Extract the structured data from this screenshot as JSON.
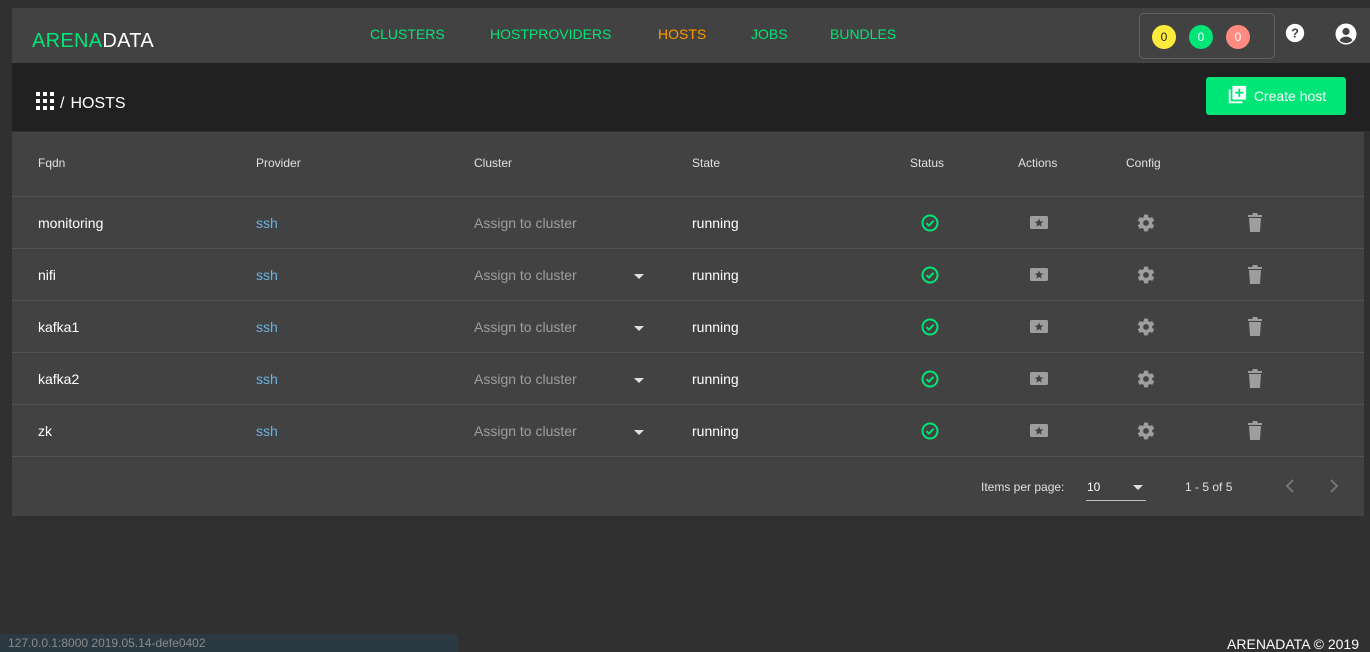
{
  "app": {
    "logo_left": "ARENA",
    "logo_right": "DATA"
  },
  "nav": [
    {
      "label": "CLUSTERS",
      "active": false
    },
    {
      "label": "HOSTPROVIDERS",
      "active": false
    },
    {
      "label": "HOSTS",
      "active": true
    },
    {
      "label": "JOBS",
      "active": false
    },
    {
      "label": "BUNDLES",
      "active": false
    }
  ],
  "job_stats": [
    {
      "value": "0",
      "color": "#ffeb3b",
      "text_color": "#212121"
    },
    {
      "value": "0",
      "color": "#00e676",
      "text_color": "#ffffff"
    },
    {
      "value": "0",
      "color": "#ff8a80",
      "text_color": "#ffffff"
    }
  ],
  "icons": {
    "help": "help-icon",
    "account": "account-icon",
    "apps": "apps-grid-icon",
    "create": "library-add-icon"
  },
  "breadcrumb": {
    "separator": "/",
    "page": "HOSTS"
  },
  "actions": {
    "create_label": "Create host"
  },
  "table": {
    "columns": [
      "Fqdn",
      "Provider",
      "Cluster",
      "State",
      "Status",
      "Actions",
      "Config"
    ],
    "rows": [
      {
        "fqdn": "monitoring",
        "provider": "ssh",
        "cluster": "Assign to cluster",
        "state": "running",
        "has_caret": false
      },
      {
        "fqdn": "nifi",
        "provider": "ssh",
        "cluster": "Assign to cluster",
        "state": "running",
        "has_caret": true
      },
      {
        "fqdn": "kafka1",
        "provider": "ssh",
        "cluster": "Assign to cluster",
        "state": "running",
        "has_caret": true
      },
      {
        "fqdn": "kafka2",
        "provider": "ssh",
        "cluster": "Assign to cluster",
        "state": "running",
        "has_caret": true
      },
      {
        "fqdn": "zk",
        "provider": "ssh",
        "cluster": "Assign to cluster",
        "state": "running",
        "has_caret": true
      }
    ]
  },
  "paginator": {
    "items_per_page_label": "Items per page:",
    "page_size": "10",
    "range": "1 - 5 of 5"
  },
  "footer": {
    "version": "127.0.0.1:8000 2019.05.14-defe0402",
    "copyright": "ARENADATA © 2019"
  },
  "colors": {
    "accent": "#00e676",
    "active_nav": "#ff9800",
    "status_ok": "#00e676",
    "icon_gray": "#9e9e9e"
  }
}
